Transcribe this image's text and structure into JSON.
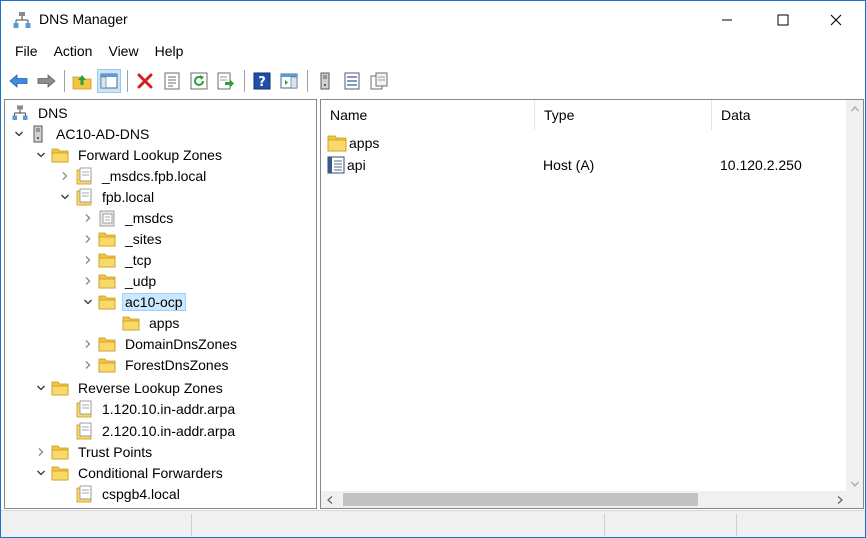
{
  "window": {
    "title": "DNS Manager",
    "app_icon": "dns-manager-icon"
  },
  "menu": {
    "items": [
      "File",
      "Action",
      "View",
      "Help"
    ]
  },
  "toolbar": {
    "buttons": [
      "back-icon",
      "forward-icon",
      "up-folder-icon",
      "show-hide-console-tree-icon",
      "delete-icon",
      "properties-icon",
      "refresh-icon",
      "export-list-icon",
      "help-icon",
      "show-hide-action-pane-icon",
      "server-icon",
      "list-icon",
      "copy-icon"
    ]
  },
  "tree": {
    "root": "DNS",
    "server": "AC10-AD-DNS",
    "forward_zones": "Forward Lookup Zones",
    "msdcs_zone": "_msdcs.fpb.local",
    "fpb_zone": "fpb.local",
    "msdcs": "_msdcs",
    "sites": "_sites",
    "tcp": "_tcp",
    "udp": "_udp",
    "ac10_ocp": "ac10-ocp",
    "apps": "apps",
    "domain_dns_zones": "DomainDnsZones",
    "forest_dns_zones": "ForestDnsZones",
    "reverse_zones": "Reverse Lookup Zones",
    "reverse_1": "1.120.10.in-addr.arpa",
    "reverse_2": "2.120.10.in-addr.arpa",
    "trust_points": "Trust Points",
    "conditional_forwarders": "Conditional Forwarders",
    "cspgb4": "cspgb4.local"
  },
  "list": {
    "columns": {
      "name": "Name",
      "type": "Type",
      "data": "Data"
    },
    "rows": [
      {
        "name": "apps",
        "type": "",
        "data": "",
        "icon": "folder-icon"
      },
      {
        "name": "api",
        "type": "Host (A)",
        "data": "10.120.2.250",
        "icon": "host-record-icon"
      }
    ]
  },
  "colors": {
    "window_border": "#1a73c8",
    "selection": "#cce8ff",
    "folder": "#f4c542"
  }
}
